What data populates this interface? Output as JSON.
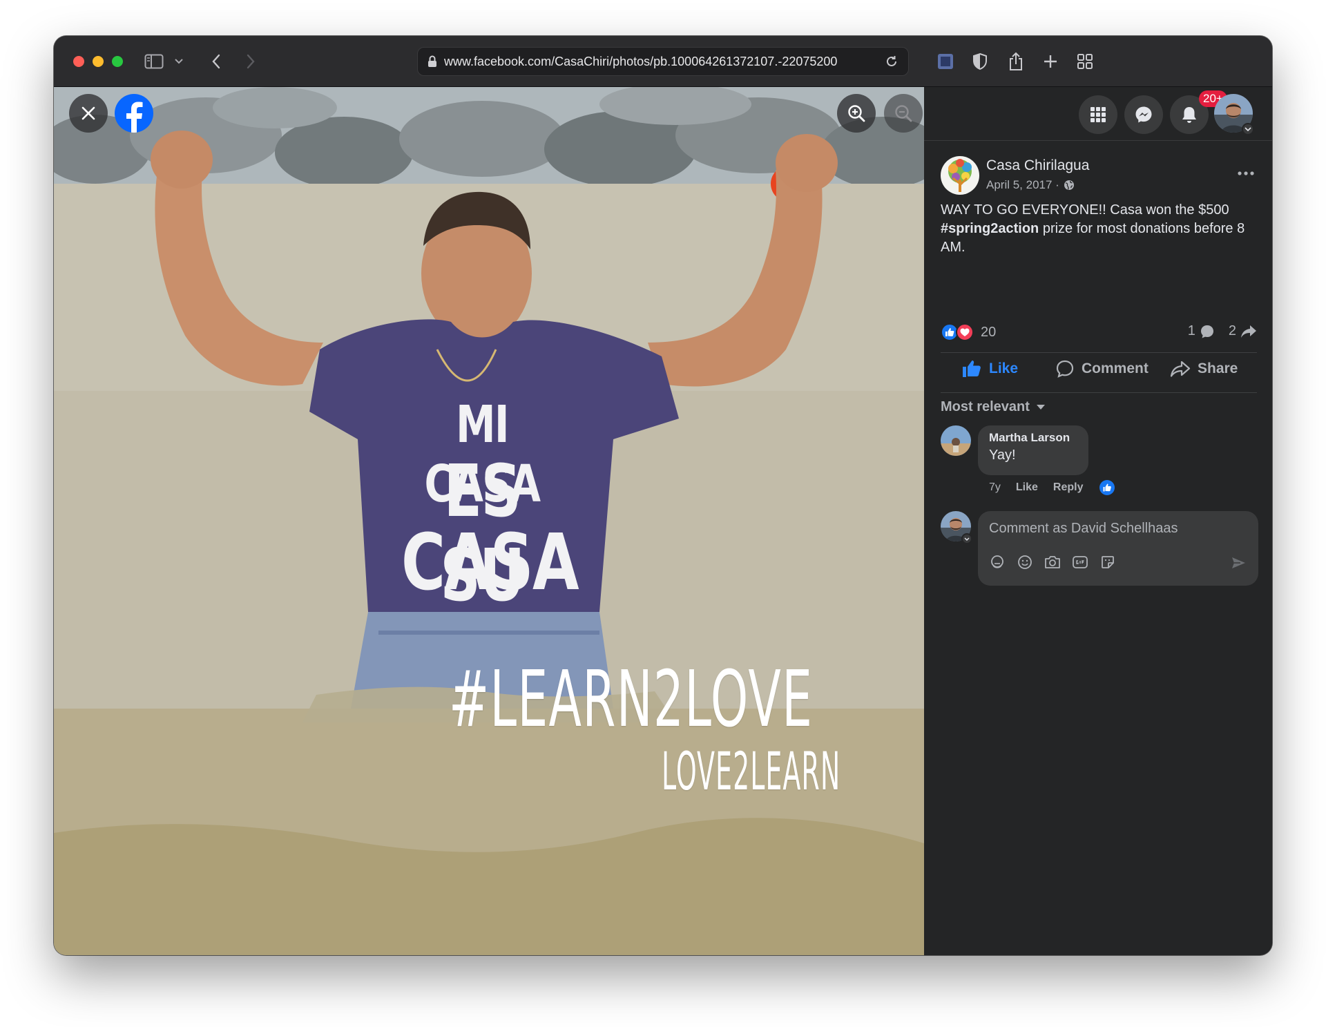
{
  "browser": {
    "url": "www.facebook.com/CasaChiri/photos/pb.100064261372107.-22075200"
  },
  "photo": {
    "shirt_lines": [
      "MI CASA",
      "ES SU",
      "CASA"
    ],
    "watermark_main": "#LEARN2LOVE",
    "watermark_sub": "LOVE2LEARN"
  },
  "nav": {
    "notifications_badge": "20+"
  },
  "post": {
    "author": "Casa Chirilagua",
    "date": "April 5, 2017 ·",
    "text_before": "WAY TO GO EVERYONE!! Casa won the $500 ",
    "hashtag": "#spring2action",
    "text_after": " prize for most donations before 8 AM.",
    "reaction_count": "20",
    "comment_count": "1",
    "share_count": "2"
  },
  "actions": {
    "like": "Like",
    "comment": "Comment",
    "share": "Share"
  },
  "comments": {
    "sort_label": "Most relevant",
    "items": [
      {
        "author": "Martha Larson",
        "text": "Yay!",
        "age": "7y",
        "like": "Like",
        "reply": "Reply"
      }
    ]
  },
  "compose": {
    "placeholder": "Comment as David Schellhaas"
  },
  "colors": {
    "facebook_blue": "#0866ff",
    "panel_bg": "#242526",
    "notification_red": "#e41e3f"
  }
}
